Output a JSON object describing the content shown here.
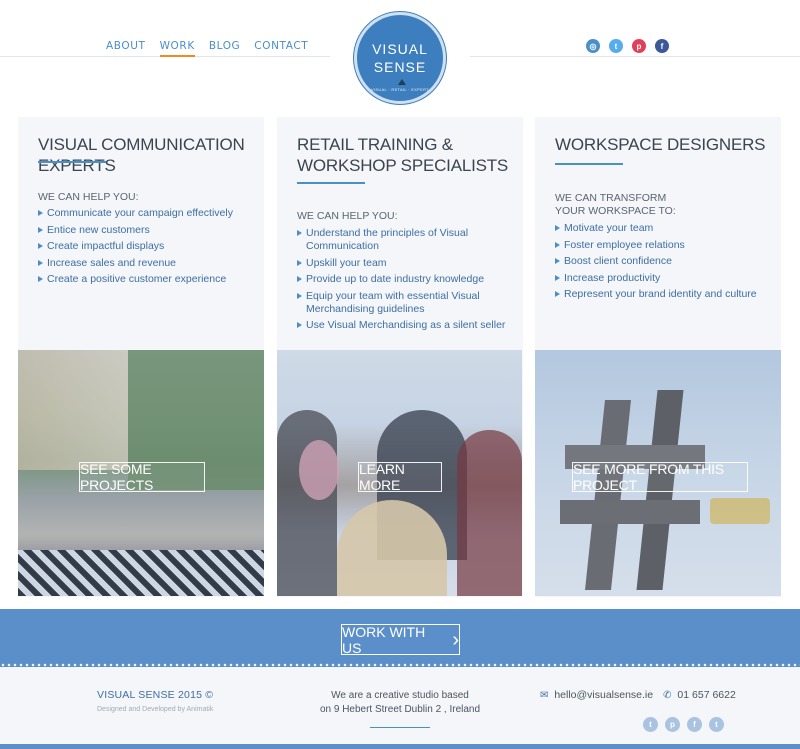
{
  "nav": {
    "items": [
      {
        "label": "ABOUT"
      },
      {
        "label": "WORK"
      },
      {
        "label": "BLOG"
      },
      {
        "label": "CONTACT"
      }
    ],
    "active": "WORK"
  },
  "logo": {
    "line1": "VISUAL",
    "line2": "SENSE",
    "tagline": "VISUAL · RETAIL · EXPERT"
  },
  "social_header": [
    {
      "icon": "instagram-icon",
      "glyph": "◎",
      "color": "#4a8fc7"
    },
    {
      "icon": "twitter-icon",
      "glyph": "t",
      "color": "#55acee"
    },
    {
      "icon": "pinterest-icon",
      "glyph": "p",
      "color": "#e0405a"
    },
    {
      "icon": "facebook-icon",
      "glyph": "f",
      "color": "#3b5998"
    }
  ],
  "columns": [
    {
      "title": "VISUAL COMMUNICATION EXPERTS",
      "subtitle": "WE CAN HELP YOU:",
      "items": [
        "Communicate your campaign effectively",
        "Entice new customers",
        "Create impactful displays",
        "Increase sales and revenue",
        "Create a positive customer experience"
      ],
      "button": "SEE SOME PROJECTS"
    },
    {
      "title": "RETAIL TRAINING & WORKSHOP SPECIALISTS",
      "subtitle": "WE CAN HELP YOU:",
      "items": [
        "Understand the principles of Visual Communication",
        "Upskill your team",
        "Provide up to date industry knowledge",
        "Equip your team with essential Visual Merchandising guidelines",
        "Use Visual Merchandising as a silent seller"
      ],
      "button": "LEARN MORE"
    },
    {
      "title": "WORKSPACE DESIGNERS",
      "subtitle": "WE CAN TRANSFORM YOUR WORKSPACE TO:",
      "items": [
        "Motivate your team",
        "Foster employee relations",
        "Boost client confidence",
        "Increase productivity",
        "Represent your brand identity and culture"
      ],
      "button": "SEE MORE FROM THIS PROJECT"
    }
  ],
  "band": {
    "button": "WORK WITH US",
    "arrow": "›"
  },
  "footer": {
    "brand": "VISUAL SENSE 2015 ©",
    "credit": "Designed and Developed by Animatik",
    "about_line1": "We are a creative studio based",
    "about_line2": "on 9 Hebert Street Dublin 2 , Ireland",
    "email": "hello@visualsense.ie",
    "phone": "01 657 6622",
    "social": [
      {
        "icon": "twitter-icon",
        "glyph": "t"
      },
      {
        "icon": "pinterest-icon",
        "glyph": "p"
      },
      {
        "icon": "facebook-icon",
        "glyph": "f"
      },
      {
        "icon": "twitter-icon",
        "glyph": "t"
      }
    ]
  }
}
